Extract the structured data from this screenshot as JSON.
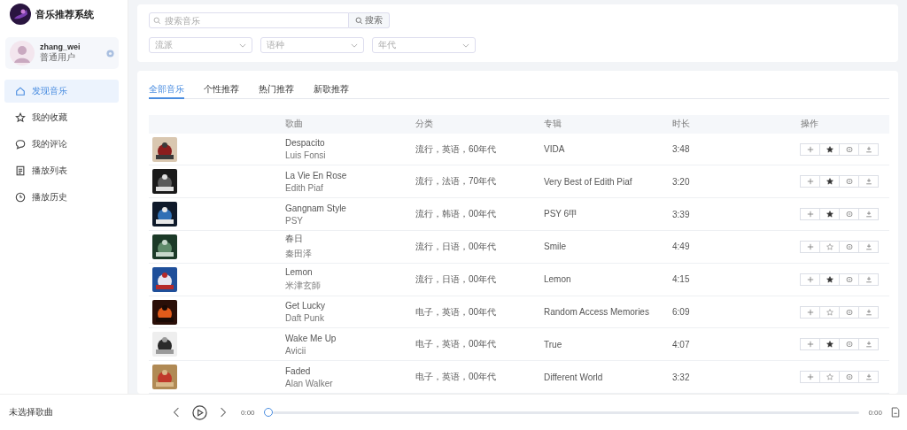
{
  "app": {
    "title": "音乐推荐系统"
  },
  "user": {
    "name": "zhang_wei",
    "role": "普通用户"
  },
  "nav": [
    {
      "label": "发现音乐",
      "selected": true
    },
    {
      "label": "我的收藏",
      "selected": false
    },
    {
      "label": "我的评论",
      "selected": false
    },
    {
      "label": "播放列表",
      "selected": false
    },
    {
      "label": "播放历史",
      "selected": false
    }
  ],
  "search": {
    "placeholder": "搜索音乐",
    "button": "搜索"
  },
  "filters": [
    {
      "placeholder": "流派"
    },
    {
      "placeholder": "语种"
    },
    {
      "placeholder": "年代"
    }
  ],
  "tabs": [
    {
      "label": "全部音乐",
      "selected": true
    },
    {
      "label": "个性推荐",
      "selected": false
    },
    {
      "label": "热门推荐",
      "selected": false
    },
    {
      "label": "新歌推荐",
      "selected": false
    }
  ],
  "table": {
    "columns": [
      "歌曲",
      "分类",
      "专辑",
      "时长",
      "操作"
    ],
    "rows": [
      {
        "title": "Despacito",
        "artist": "Luis Fonsi",
        "category": "流行，英语，60年代",
        "album": "VIDA",
        "duration": "3:48",
        "favorited": true
      },
      {
        "title": "La Vie En Rose",
        "artist": "Edith Piaf",
        "category": "流行，法语，70年代",
        "album": "Very Best of Edith Piaf",
        "duration": "3:20",
        "favorited": true
      },
      {
        "title": "Gangnam Style",
        "artist": "PSY",
        "category": "流行，韩语，00年代",
        "album": "PSY 6甲",
        "duration": "3:39",
        "favorited": true
      },
      {
        "title": "春日",
        "artist": "秦田泽",
        "category": "流行，日语，00年代",
        "album": "Smile",
        "duration": "4:49",
        "favorited": false
      },
      {
        "title": "Lemon",
        "artist": "米津玄師",
        "category": "流行，日语，00年代",
        "album": "Lemon",
        "duration": "4:15",
        "favorited": true
      },
      {
        "title": "Get Lucky",
        "artist": "Daft Punk",
        "category": "电子，英语，00年代",
        "album": "Random Access Memories",
        "duration": "6:09",
        "favorited": false
      },
      {
        "title": "Wake Me Up",
        "artist": "Avicii",
        "category": "电子，英语，00年代",
        "album": "True",
        "duration": "4:07",
        "favorited": true
      },
      {
        "title": "Faded",
        "artist": "Alan Walker",
        "category": "电子，英语，00年代",
        "album": "Different World",
        "duration": "3:32",
        "favorited": false
      }
    ]
  },
  "player": {
    "track": "未选择歌曲",
    "elapsed": "0:00",
    "total": "0:00",
    "level": 0
  }
}
